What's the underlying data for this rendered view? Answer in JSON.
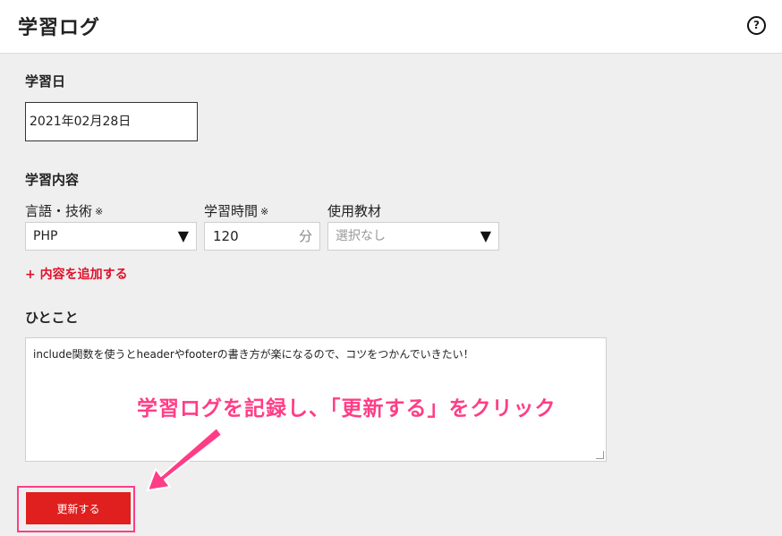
{
  "header": {
    "title": "学習ログ",
    "help_icon": "help-circle-icon"
  },
  "form": {
    "date": {
      "label": "学習日",
      "value": "2021年02月28日"
    },
    "content": {
      "section_label": "学習内容",
      "language": {
        "label": "言語・技術",
        "required_mark": "※",
        "selected": "PHP"
      },
      "time": {
        "label": "学習時間",
        "required_mark": "※",
        "value": "120",
        "unit": "分"
      },
      "material": {
        "label": "使用教材",
        "placeholder": "選択なし"
      },
      "add_link": "+ 内容を追加する"
    },
    "comment": {
      "label": "ひとこと",
      "value": "include関数を使うとheaderやfooterの書き方が楽になるので、コツをつかんでいきたい！"
    },
    "submit_label": "更新する"
  },
  "annotation": {
    "text": "学習ログを記録し、「更新する」をクリック",
    "color": "#ff3d86"
  },
  "colors": {
    "accent_red": "#e01f1f",
    "link_red": "#e0102a",
    "annotation_pink": "#ff3d86"
  }
}
